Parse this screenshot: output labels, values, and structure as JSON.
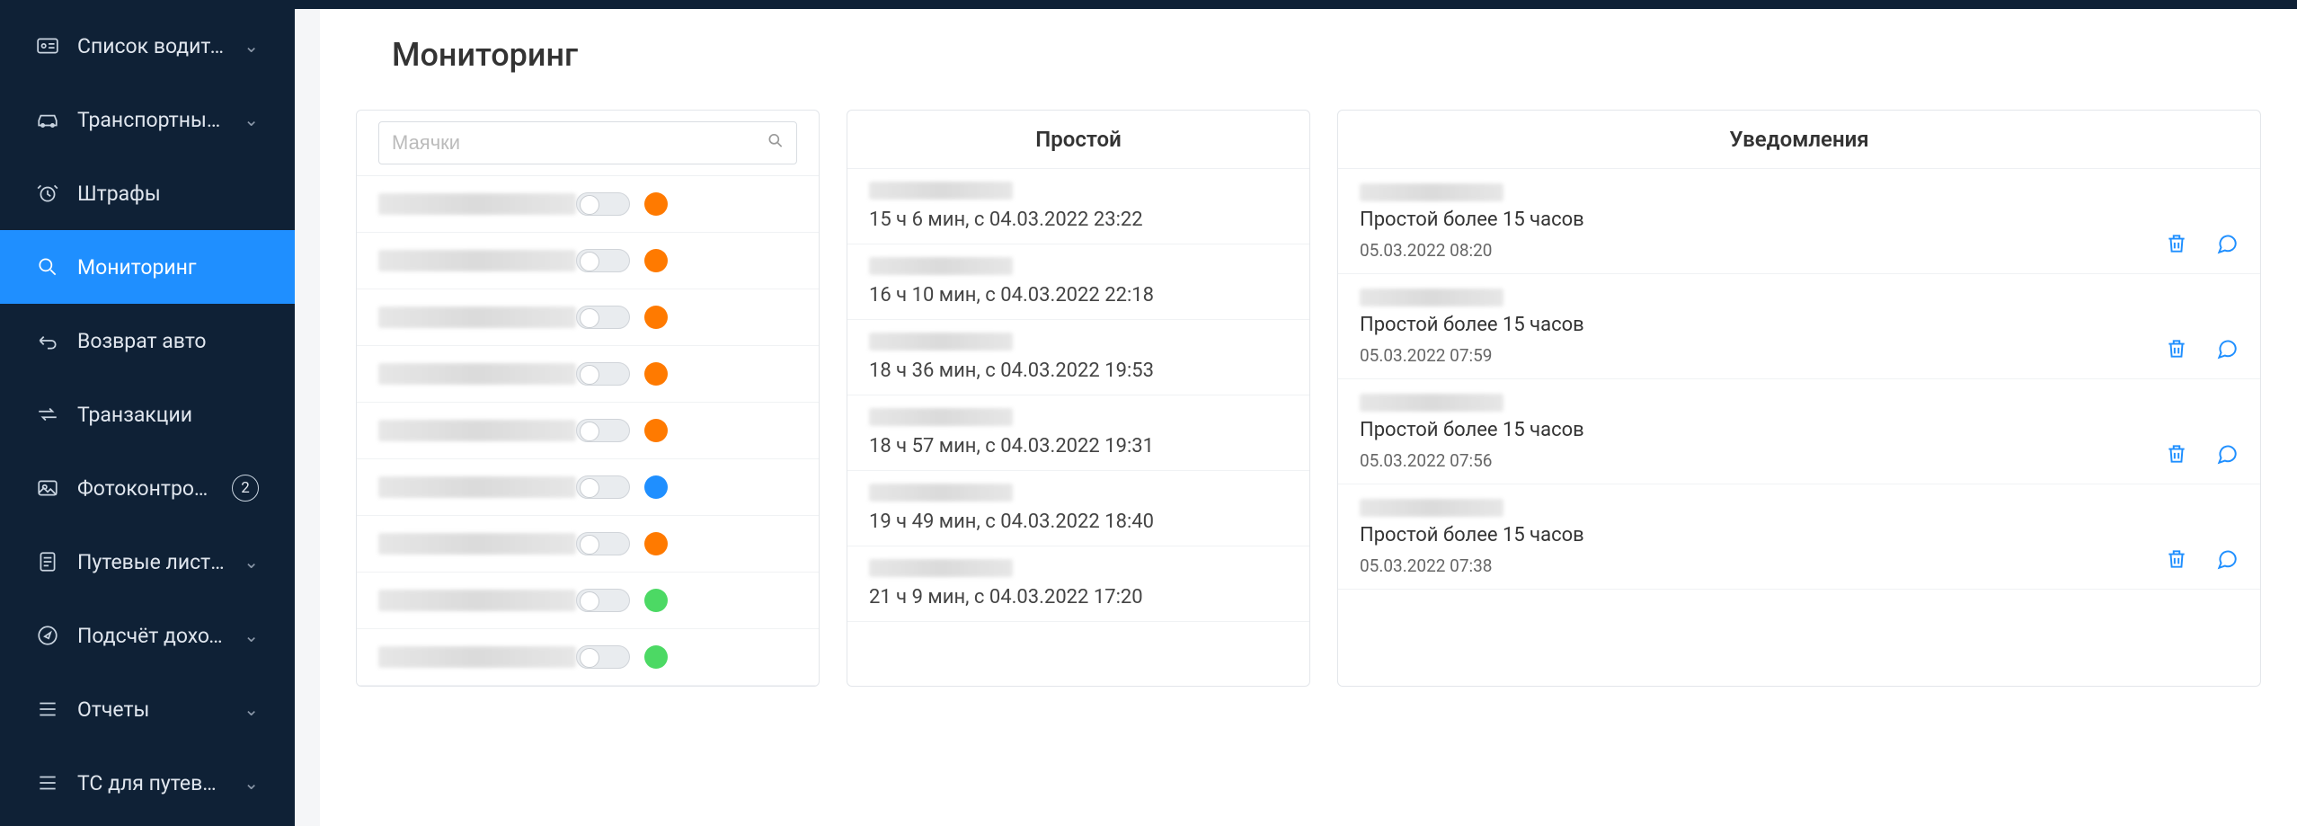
{
  "sidebar": {
    "items": [
      {
        "label": "Список водителей",
        "icon": "id-card",
        "expandable": true
      },
      {
        "label": "Транспортные с...",
        "icon": "car",
        "expandable": true
      },
      {
        "label": "Штрафы",
        "icon": "alarm",
        "expandable": false
      },
      {
        "label": "Мониторинг",
        "icon": "search",
        "expandable": false,
        "active": true
      },
      {
        "label": "Возврат авто",
        "icon": "return",
        "expandable": false
      },
      {
        "label": "Транзакции",
        "icon": "transfer",
        "expandable": false
      },
      {
        "label": "Фотоконтроль",
        "icon": "image",
        "expandable": false,
        "badge": "2"
      },
      {
        "label": "Путевые листы",
        "icon": "document",
        "expandable": true
      },
      {
        "label": "Подсчёт дохода",
        "icon": "compass",
        "expandable": true
      },
      {
        "label": "Отчеты",
        "icon": "list",
        "expandable": true
      },
      {
        "label": "ТС для путевых ...",
        "icon": "list2",
        "expandable": true
      }
    ]
  },
  "page": {
    "title": "Мониторинг"
  },
  "beacons": {
    "search_placeholder": "Маячки",
    "rows": [
      {
        "status": "orange"
      },
      {
        "status": "orange"
      },
      {
        "status": "orange"
      },
      {
        "status": "orange"
      },
      {
        "status": "orange"
      },
      {
        "status": "blue"
      },
      {
        "status": "orange"
      },
      {
        "status": "green"
      },
      {
        "status": "green"
      }
    ]
  },
  "downtime": {
    "header": "Простой",
    "rows": [
      {
        "text": "15 ч 6 мин, с 04.03.2022 23:22"
      },
      {
        "text": "16 ч 10 мин, с 04.03.2022 22:18"
      },
      {
        "text": "18 ч 36 мин, с 04.03.2022 19:53"
      },
      {
        "text": "18 ч 57 мин, с 04.03.2022 19:31"
      },
      {
        "text": "19 ч 49 мин, с 04.03.2022 18:40"
      },
      {
        "text": "21 ч 9 мин, с 04.03.2022 17:20"
      }
    ]
  },
  "notifications": {
    "header": "Уведомления",
    "rows": [
      {
        "title": "Простой более 15 часов",
        "date": "05.03.2022 08:20"
      },
      {
        "title": "Простой более 15 часов",
        "date": "05.03.2022 07:59"
      },
      {
        "title": "Простой более 15 часов",
        "date": "05.03.2022 07:56"
      },
      {
        "title": "Простой более 15 часов",
        "date": "05.03.2022 07:38"
      }
    ]
  }
}
